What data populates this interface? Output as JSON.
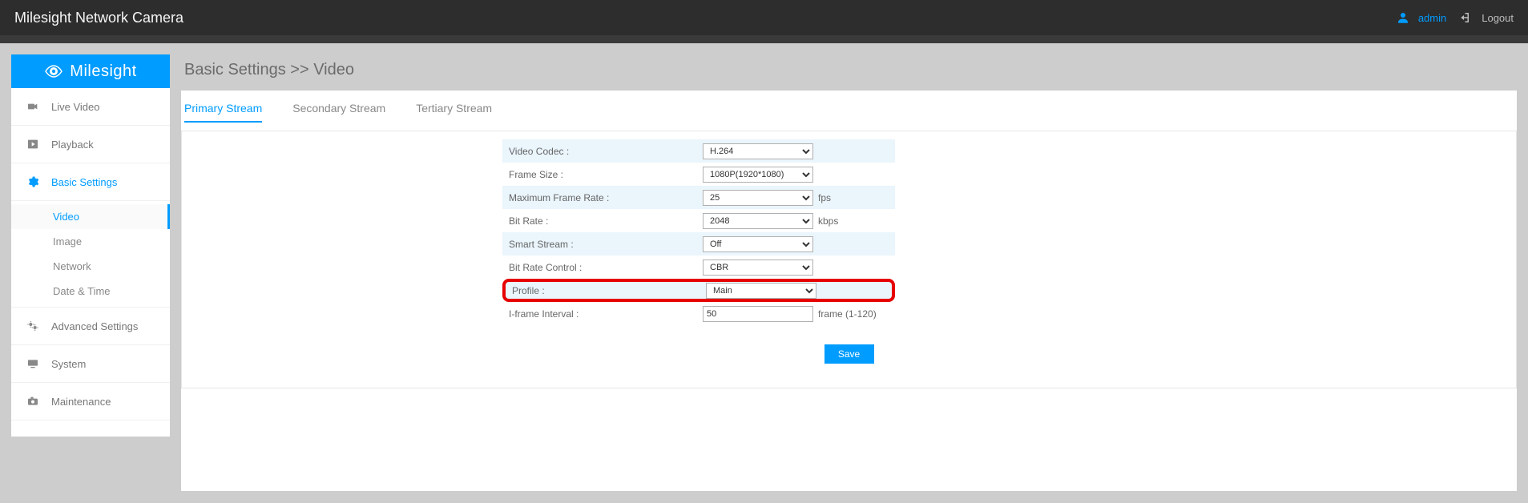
{
  "header": {
    "title": "Milesight Network Camera",
    "user": "admin",
    "logout": "Logout"
  },
  "sidebar": {
    "brand": "Milesight",
    "items": [
      {
        "label": "Live Video"
      },
      {
        "label": "Playback"
      },
      {
        "label": "Basic Settings"
      },
      {
        "label": "Advanced Settings"
      },
      {
        "label": "System"
      },
      {
        "label": "Maintenance"
      }
    ],
    "basic_sub": [
      {
        "label": "Video"
      },
      {
        "label": "Image"
      },
      {
        "label": "Network"
      },
      {
        "label": "Date & Time"
      }
    ]
  },
  "breadcrumb": "Basic Settings >> Video",
  "tabs": [
    {
      "label": "Primary Stream"
    },
    {
      "label": "Secondary Stream"
    },
    {
      "label": "Tertiary Stream"
    }
  ],
  "rows": {
    "video_codec_label": "Video Codec :",
    "video_codec_value": "H.264",
    "frame_size_label": "Frame Size :",
    "frame_size_value": "1080P(1920*1080)",
    "max_fr_label": "Maximum Frame Rate :",
    "max_fr_value": "25",
    "max_fr_suffix": "fps",
    "bitrate_label": "Bit Rate :",
    "bitrate_value": "2048",
    "bitrate_suffix": "kbps",
    "smart_label": "Smart Stream :",
    "smart_value": "Off",
    "brc_label": "Bit Rate Control :",
    "brc_value": "CBR",
    "profile_label": "Profile :",
    "profile_value": "Main",
    "iframe_label": "I-frame Interval :",
    "iframe_value": "50",
    "iframe_suffix": "frame (1-120)"
  },
  "save_label": "Save"
}
